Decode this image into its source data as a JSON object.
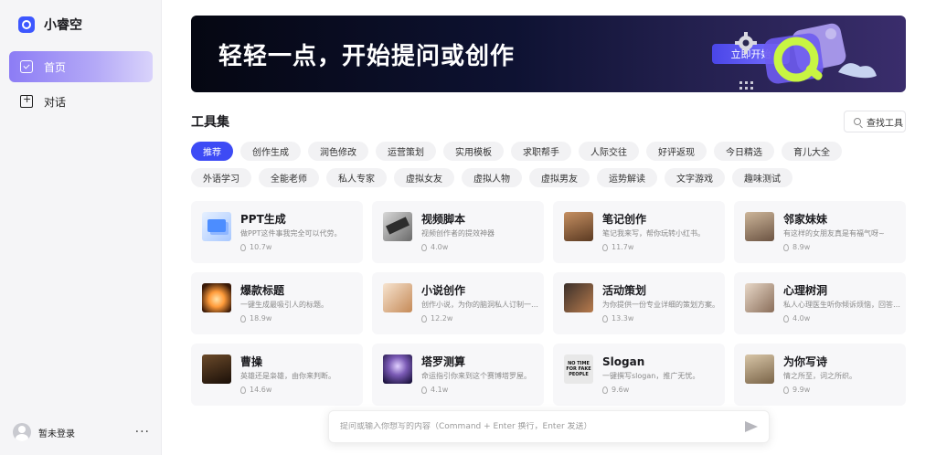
{
  "brand": {
    "name": "小睿空",
    "logo_icon": "ring-logo-icon",
    "color": "#3d57ff"
  },
  "nav": [
    {
      "label": "首页",
      "icon": "home-icon",
      "active": true
    },
    {
      "label": "对话",
      "icon": "chat-add-icon",
      "active": false
    }
  ],
  "user": {
    "name": "暂未登录",
    "more": "···"
  },
  "banner": {
    "title": "轻轻一点，开始提问或创作",
    "button": "立即开始"
  },
  "tools": {
    "title": "工具集",
    "search_label": "查找工具",
    "chips": [
      "推荐",
      "创作生成",
      "润色修改",
      "运营策划",
      "实用模板",
      "求职帮手",
      "人际交往",
      "好评返现",
      "今日精选",
      "育儿大全",
      "外语学习",
      "全能老师",
      "私人专家",
      "虚拟女友",
      "虚拟人物",
      "虚拟男友",
      "运势解读",
      "文字游戏",
      "趣味测试"
    ],
    "active_chip": 0
  },
  "cards": [
    {
      "title": "PPT生成",
      "desc": "做PPT这件事我完全可以代劳。",
      "count": "10.7w",
      "thumb": "t-ppt"
    },
    {
      "title": "视频脚本",
      "desc": "视频创作者的提效神器",
      "count": "4.0w",
      "thumb": "t-video"
    },
    {
      "title": "笔记创作",
      "desc": "笔记我来写，帮你玩转小红书。",
      "count": "11.7w",
      "thumb": "t-note"
    },
    {
      "title": "邻家妹妹",
      "desc": "有这样的女朋友真是有福气呀~",
      "count": "8.9w",
      "thumb": "t-girl"
    },
    {
      "title": "爆款标题",
      "desc": "一键生成最吸引人的标题。",
      "count": "18.9w",
      "thumb": "t-fire"
    },
    {
      "title": "小说创作",
      "desc": "创作小说，为你的脑洞私人订制一…",
      "count": "12.2w",
      "thumb": "t-novel"
    },
    {
      "title": "活动策划",
      "desc": "为你提供一份专业详细的策划方案。",
      "count": "13.3w",
      "thumb": "t-event"
    },
    {
      "title": "心理树洞",
      "desc": "私人心理医生听你倾诉烦恼，回答…",
      "count": "4.0w",
      "thumb": "t-mind"
    },
    {
      "title": "曹操",
      "desc": "英雄还是枭雄，由你来判断。",
      "count": "14.6w",
      "thumb": "t-cao"
    },
    {
      "title": "塔罗测算",
      "desc": "命运指引你来到这个赛博塔罗屋。",
      "count": "4.1w",
      "thumb": "t-tarot"
    },
    {
      "title": "Slogan",
      "desc": "一键撰写slogan，推广无忧。",
      "count": "9.6w",
      "thumb": "t-slogan",
      "thumb_text": "NO TIME FOR FAKE PEOPLE"
    },
    {
      "title": "为你写诗",
      "desc": "情之所至，词之所织。",
      "count": "9.9w",
      "thumb": "t-poem"
    }
  ],
  "composer": {
    "placeholder": "提问或输入你想写的内容（Command + Enter 换行，Enter 发送）",
    "send_icon": "send-icon"
  },
  "colors": {
    "accent": "#3d4bf5",
    "nav_active": "#8c7cf5"
  }
}
